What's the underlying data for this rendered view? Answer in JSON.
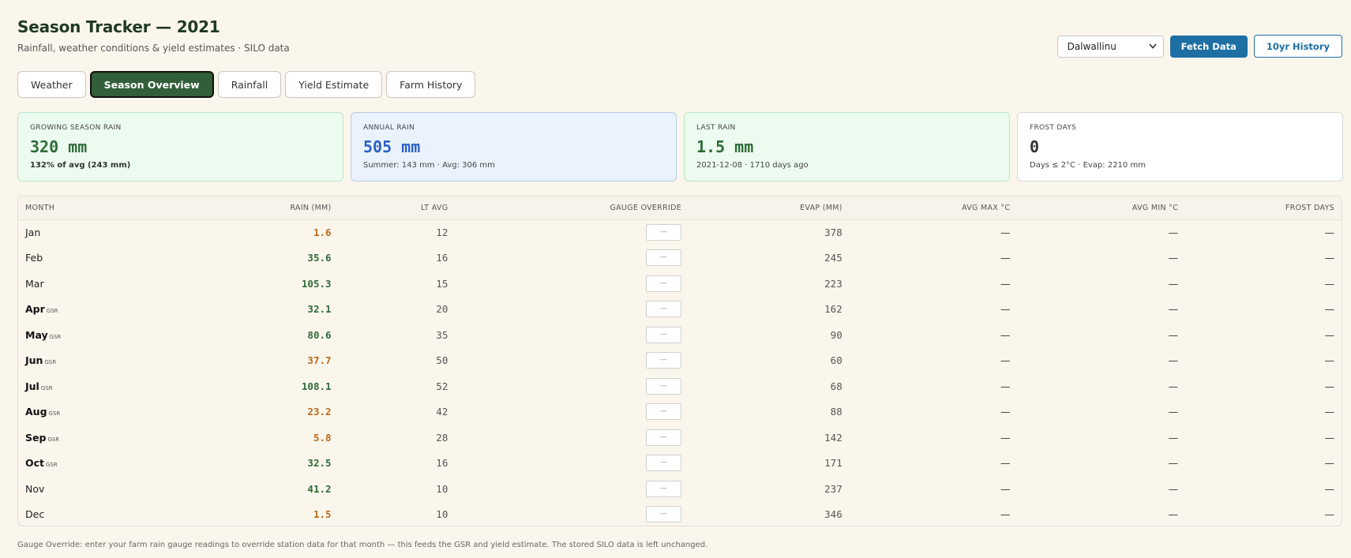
{
  "header": {
    "title": "Season Tracker — 2021",
    "subtitle": "Rainfall, weather conditions & yield estimates · SILO data"
  },
  "controls": {
    "location": "Dalwallinu",
    "fetch_label": "Fetch Data",
    "history_label": "10yr History"
  },
  "tabs": [
    {
      "label": "Weather",
      "active": false
    },
    {
      "label": "Season Overview",
      "active": true
    },
    {
      "label": "Rainfall",
      "active": false
    },
    {
      "label": "Yield Estimate",
      "active": false
    },
    {
      "label": "Farm History",
      "active": false
    }
  ],
  "cards": [
    {
      "label": "GROWING SEASON RAIN",
      "value": "320 mm",
      "note": "132% of avg (243 mm)",
      "style": "green"
    },
    {
      "label": "ANNUAL RAIN",
      "value": "505 mm",
      "note": "Summer: 143 mm · Avg: 306 mm",
      "style": "blue"
    },
    {
      "label": "LAST RAIN",
      "value": "1.5 mm",
      "note": "2021-12-08 · 1710 days ago",
      "style": "green"
    },
    {
      "label": "FROST DAYS",
      "value": "0",
      "note": "Days ≤ 2°C · Evap: 2210 mm",
      "style": "white"
    }
  ],
  "table": {
    "columns": [
      "MONTH",
      "RAIN (MM)",
      "LT AVG",
      "GAUGE OVERRIDE",
      "EVAP (MM)",
      "AVG MAX °C",
      "AVG MIN °C",
      "FROST DAYS"
    ],
    "gsr_tag": "GSR",
    "gauge_placeholder": "—",
    "rows": [
      {
        "month": "Jan",
        "gsr": false,
        "rain": "1.6",
        "rain_level": "low",
        "lt_avg": "12",
        "evap": "378",
        "max": "—",
        "min": "—",
        "frost": "—"
      },
      {
        "month": "Feb",
        "gsr": false,
        "rain": "35.6",
        "rain_level": "good",
        "lt_avg": "16",
        "evap": "245",
        "max": "—",
        "min": "—",
        "frost": "—"
      },
      {
        "month": "Mar",
        "gsr": false,
        "rain": "105.3",
        "rain_level": "good",
        "lt_avg": "15",
        "evap": "223",
        "max": "—",
        "min": "—",
        "frost": "—"
      },
      {
        "month": "Apr",
        "gsr": true,
        "rain": "32.1",
        "rain_level": "good",
        "lt_avg": "20",
        "evap": "162",
        "max": "—",
        "min": "—",
        "frost": "—"
      },
      {
        "month": "May",
        "gsr": true,
        "rain": "80.6",
        "rain_level": "good",
        "lt_avg": "35",
        "evap": "90",
        "max": "—",
        "min": "—",
        "frost": "—"
      },
      {
        "month": "Jun",
        "gsr": true,
        "rain": "37.7",
        "rain_level": "low",
        "lt_avg": "50",
        "evap": "60",
        "max": "—",
        "min": "—",
        "frost": "—"
      },
      {
        "month": "Jul",
        "gsr": true,
        "rain": "108.1",
        "rain_level": "good",
        "lt_avg": "52",
        "evap": "68",
        "max": "—",
        "min": "—",
        "frost": "—"
      },
      {
        "month": "Aug",
        "gsr": true,
        "rain": "23.2",
        "rain_level": "low",
        "lt_avg": "42",
        "evap": "88",
        "max": "—",
        "min": "—",
        "frost": "—"
      },
      {
        "month": "Sep",
        "gsr": true,
        "rain": "5.8",
        "rain_level": "low",
        "lt_avg": "28",
        "evap": "142",
        "max": "—",
        "min": "—",
        "frost": "—"
      },
      {
        "month": "Oct",
        "gsr": true,
        "rain": "32.5",
        "rain_level": "good",
        "lt_avg": "16",
        "evap": "171",
        "max": "—",
        "min": "—",
        "frost": "—"
      },
      {
        "month": "Nov",
        "gsr": false,
        "rain": "41.2",
        "rain_level": "good",
        "lt_avg": "10",
        "evap": "237",
        "max": "—",
        "min": "—",
        "frost": "—"
      },
      {
        "month": "Dec",
        "gsr": false,
        "rain": "1.5",
        "rain_level": "low",
        "lt_avg": "10",
        "evap": "346",
        "max": "—",
        "min": "—",
        "frost": "—"
      }
    ]
  },
  "footnote": "Gauge Override: enter your farm rain gauge readings to override station data for that month — this feeds the GSR and yield estimate. The stored SILO data is left unchanged.",
  "colors": {
    "background": "#fbf6ec",
    "primary": "#1d6fa4",
    "active_tab": "#325f39",
    "rain_good": "#2e6b37",
    "rain_low": "#b96a1e"
  },
  "icons": {
    "select_arrow": "chevron-down-icon"
  }
}
